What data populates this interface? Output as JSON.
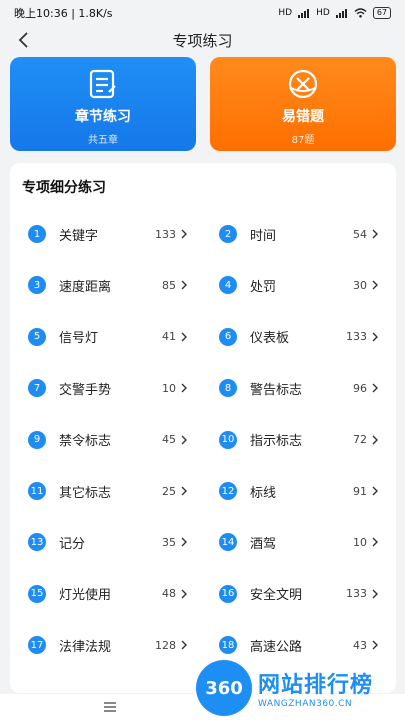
{
  "status_bar": {
    "time": "晚上10:36 | 1.8K/s",
    "signal1": "HD",
    "signal2": "HD",
    "battery": "67"
  },
  "nav": {
    "title": "专项练习",
    "back_icon": "chevron-left-icon"
  },
  "cards": [
    {
      "label": "章节练习",
      "sub": "共五章",
      "color": "#1a86f2",
      "icon": "document-icon"
    },
    {
      "label": "易错题",
      "sub": "87题",
      "color": "#ff7d0f",
      "icon": "cross-circle-icon"
    }
  ],
  "panel": {
    "title": "专项细分练习",
    "items": [
      {
        "n": "1",
        "name": "关键字",
        "count": "133"
      },
      {
        "n": "2",
        "name": "时间",
        "count": "54"
      },
      {
        "n": "3",
        "name": "速度距离",
        "count": "85"
      },
      {
        "n": "4",
        "name": "处罚",
        "count": "30"
      },
      {
        "n": "5",
        "name": "信号灯",
        "count": "41"
      },
      {
        "n": "6",
        "name": "仪表板",
        "count": "133"
      },
      {
        "n": "7",
        "name": "交警手势",
        "count": "10"
      },
      {
        "n": "8",
        "name": "警告标志",
        "count": "96"
      },
      {
        "n": "9",
        "name": "禁令标志",
        "count": "45"
      },
      {
        "n": "10",
        "name": "指示标志",
        "count": "72"
      },
      {
        "n": "11",
        "name": "其它标志",
        "count": "25"
      },
      {
        "n": "12",
        "name": "标线",
        "count": "91"
      },
      {
        "n": "13",
        "name": "记分",
        "count": "35"
      },
      {
        "n": "14",
        "name": "酒驾",
        "count": "10"
      },
      {
        "n": "15",
        "name": "灯光使用",
        "count": "48"
      },
      {
        "n": "16",
        "name": "安全文明",
        "count": "133"
      },
      {
        "n": "17",
        "name": "法律法规",
        "count": "128"
      },
      {
        "n": "18",
        "name": "高速公路",
        "count": "43"
      }
    ]
  },
  "bottom_bar": {
    "icon": "menu-icon"
  },
  "watermark": {
    "circle": "360",
    "title": "网站排行榜",
    "url": "WANGZHAN360.CN"
  }
}
